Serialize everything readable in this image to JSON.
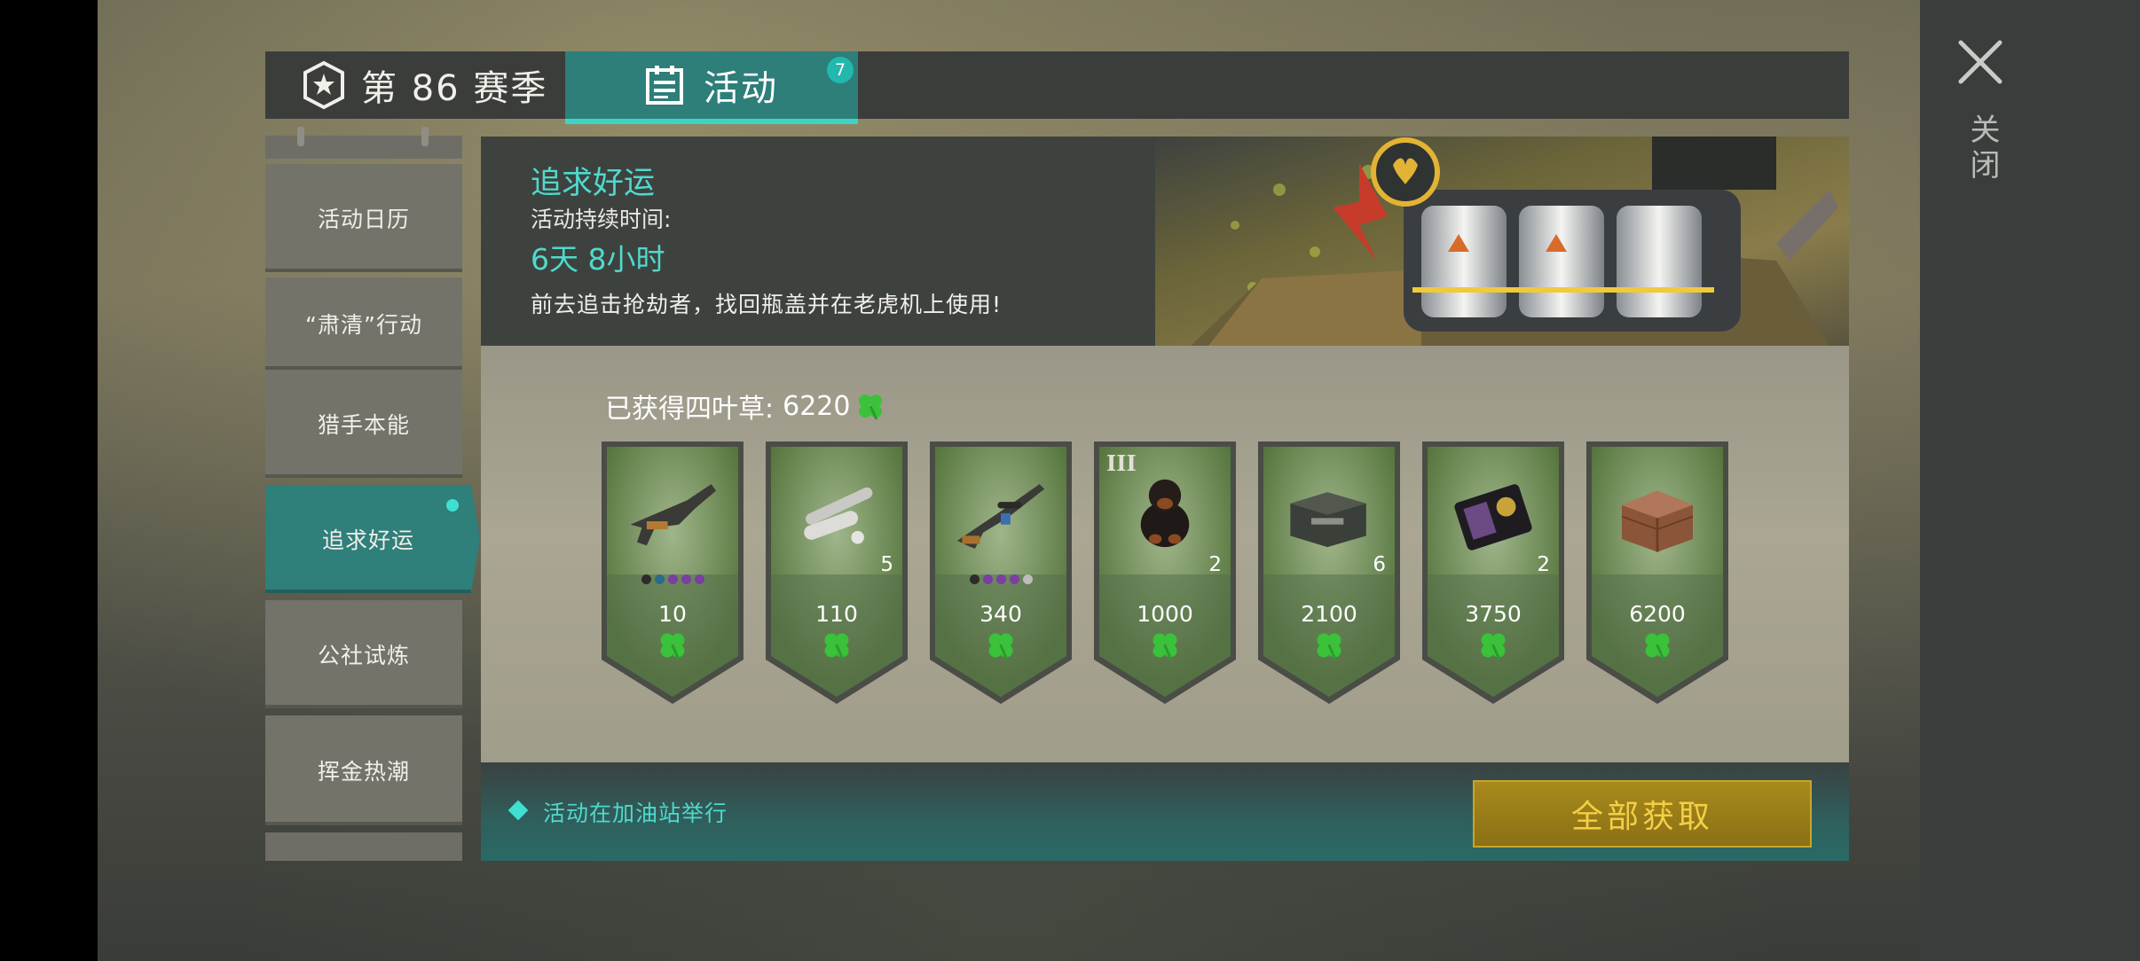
{
  "tabs": {
    "season_label": "第 86 赛季",
    "activity_label": "活动",
    "activity_badge": "7"
  },
  "close": {
    "label": "关闭"
  },
  "sidebar": {
    "items": [
      {
        "label": "活动日历"
      },
      {
        "label": "“肃清”行动"
      },
      {
        "label": "猎手本能"
      },
      {
        "label": "追求好运",
        "active": true
      },
      {
        "label": "公社试炼"
      },
      {
        "label": "挥金热潮"
      }
    ]
  },
  "event": {
    "title": "追求好运",
    "duration_label": "活动持续时间:",
    "duration": "6天 8小时",
    "description": "前去追击抢劫者，找回瓶盖并在老虎机上使用!"
  },
  "earned": {
    "label": "已获得四叶草:",
    "value": "6220",
    "icon": "clover-icon"
  },
  "rewards": [
    {
      "name": "smg-weapon",
      "cost": "10",
      "dots": [
        "#2c2c2c",
        "#2c6a8a",
        "#7a3fa0",
        "#7a3fa0",
        "#7a3fa0"
      ]
    },
    {
      "name": "weapon-parts",
      "cost": "110",
      "qty": "5"
    },
    {
      "name": "sniper-rifle",
      "cost": "340",
      "dots": [
        "#2c2c2c",
        "#7a3fa0",
        "#7a3fa0",
        "#7a3fa0",
        "#bdbdbd"
      ]
    },
    {
      "name": "rottweiler-dog",
      "cost": "1000",
      "qty": "2",
      "tier": "III"
    },
    {
      "name": "weapon-crate",
      "cost": "2100",
      "qty": "6"
    },
    {
      "name": "police-badge",
      "cost": "3750",
      "qty": "2"
    },
    {
      "name": "wooden-structure",
      "cost": "6200"
    }
  ],
  "footer": {
    "note": "活动在加油站举行",
    "claim_all": "全部获取"
  },
  "colors": {
    "accent": "#3fd3c6",
    "button_gold": "#a88a1c",
    "clover_green": "#39c23a"
  }
}
